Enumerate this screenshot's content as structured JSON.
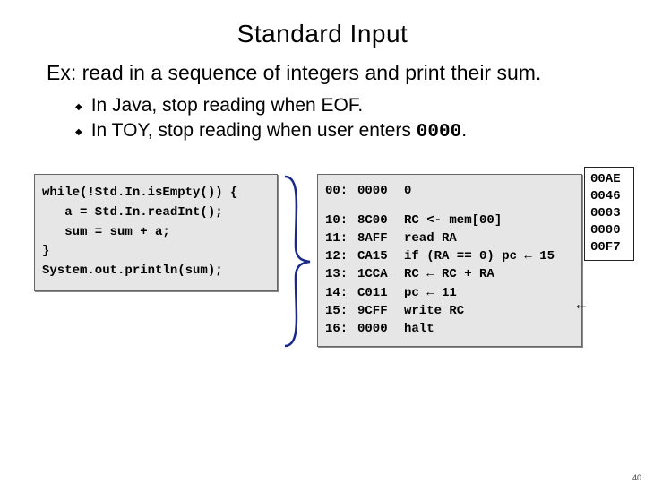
{
  "title": "Standard Input",
  "subtitle": "Ex:  read in a sequence of integers and print their sum.",
  "bullet1": "In Java, stop reading when EOF.",
  "bullet2_pre": "In TOY, stop reading when user enters",
  "bullet2_code": "0000",
  "bullet2_post": ".",
  "java": {
    "l1": "while(!Std.In.isEmpty()) {",
    "l2": "   a = Std.In.readInt();",
    "l3": "   sum = sum + a;",
    "l4": "}",
    "l5": "System.out.println(sum);"
  },
  "toy": [
    {
      "addr": "00:",
      "val": "0000",
      "cmt": "0"
    },
    null,
    {
      "addr": "10:",
      "val": "8C00",
      "cmt": "RC <- mem[00]"
    },
    {
      "addr": "11:",
      "val": "8AFF",
      "cmt": "read RA"
    },
    {
      "addr": "12:",
      "val": "CA15",
      "cmt": "if (RA == 0) pc ← 15",
      "arrow": true
    },
    {
      "addr": "13:",
      "val": "1CCA",
      "cmt": "RC ← RC + RA",
      "arrow": true
    },
    {
      "addr": "14:",
      "val": "C011",
      "cmt": "pc ← 11",
      "arrow": true
    },
    {
      "addr": "15:",
      "val": "9CFF",
      "cmt": "write RC"
    },
    {
      "addr": "16:",
      "val": "0000",
      "cmt": "halt"
    }
  ],
  "inputdata": [
    "00AE",
    "0046",
    "0003",
    "0000",
    "00F7"
  ],
  "pagenum": "40"
}
